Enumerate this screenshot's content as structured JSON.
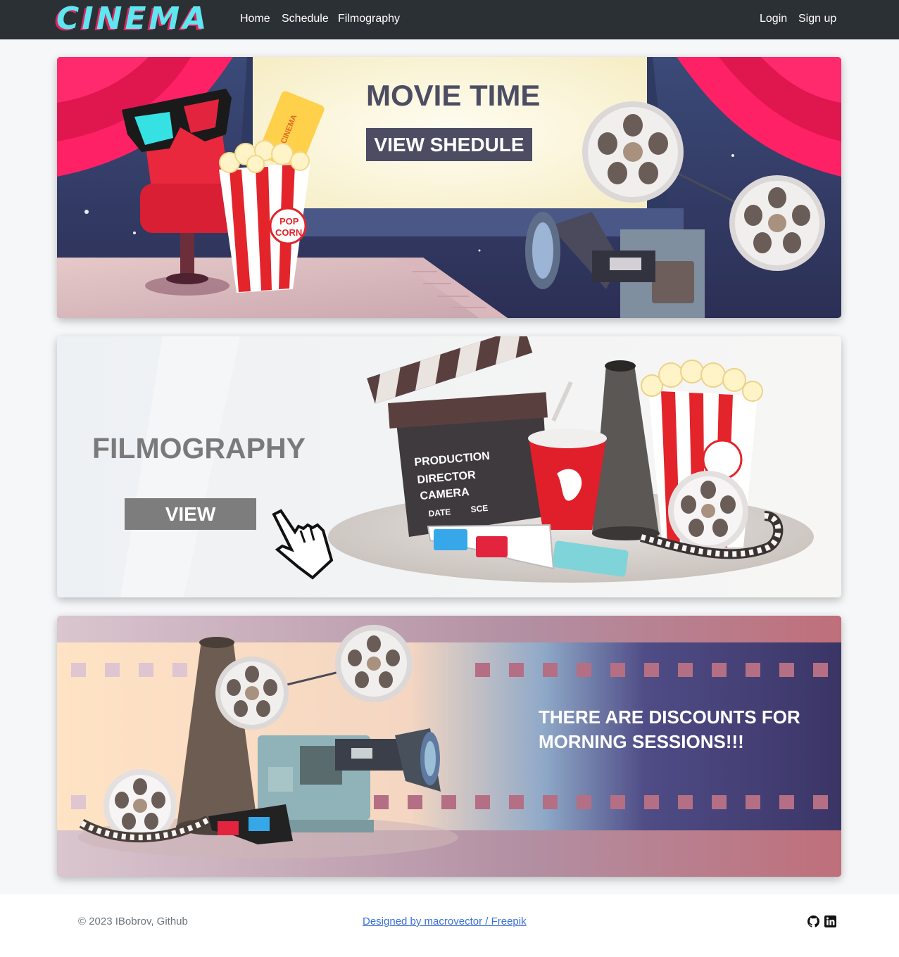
{
  "nav": {
    "brand": "CINEMA",
    "links": [
      "Home",
      "Schedule",
      "Filmography"
    ],
    "auth": [
      "Login",
      "Sign up"
    ]
  },
  "banners": [
    {
      "title": "MOVIE TIME",
      "button": "VIEW SHEDULE"
    },
    {
      "title": "FILMOGRAPHY",
      "button": "VIEW"
    },
    {
      "title_lines": [
        "THERE ARE DISCOUNTS FOR",
        "MORNING SESSIONS!!!"
      ]
    }
  ],
  "illustration_text": {
    "ticket": "CINEMA",
    "popcorn_top": "POP",
    "popcorn_bottom": "CORN",
    "clapper": [
      "PRODUCTION",
      "DIRECTOR",
      "CAMERA",
      "DATE",
      "SCE"
    ]
  },
  "footer": {
    "copyright": "© 2023 IBobrov, Github",
    "credit": "Designed by macrovector / Freepik"
  },
  "colors": {
    "navbar": "#2b3035",
    "brand": "#5ee7f0",
    "brand_shadow": "#e0245e",
    "button_dark": "#4c4d63",
    "button_gray": "#7d7d7d",
    "link": "#3b6fd9"
  },
  "icons": [
    "github-icon",
    "linkedin-icon",
    "pointer-hand-icon"
  ]
}
